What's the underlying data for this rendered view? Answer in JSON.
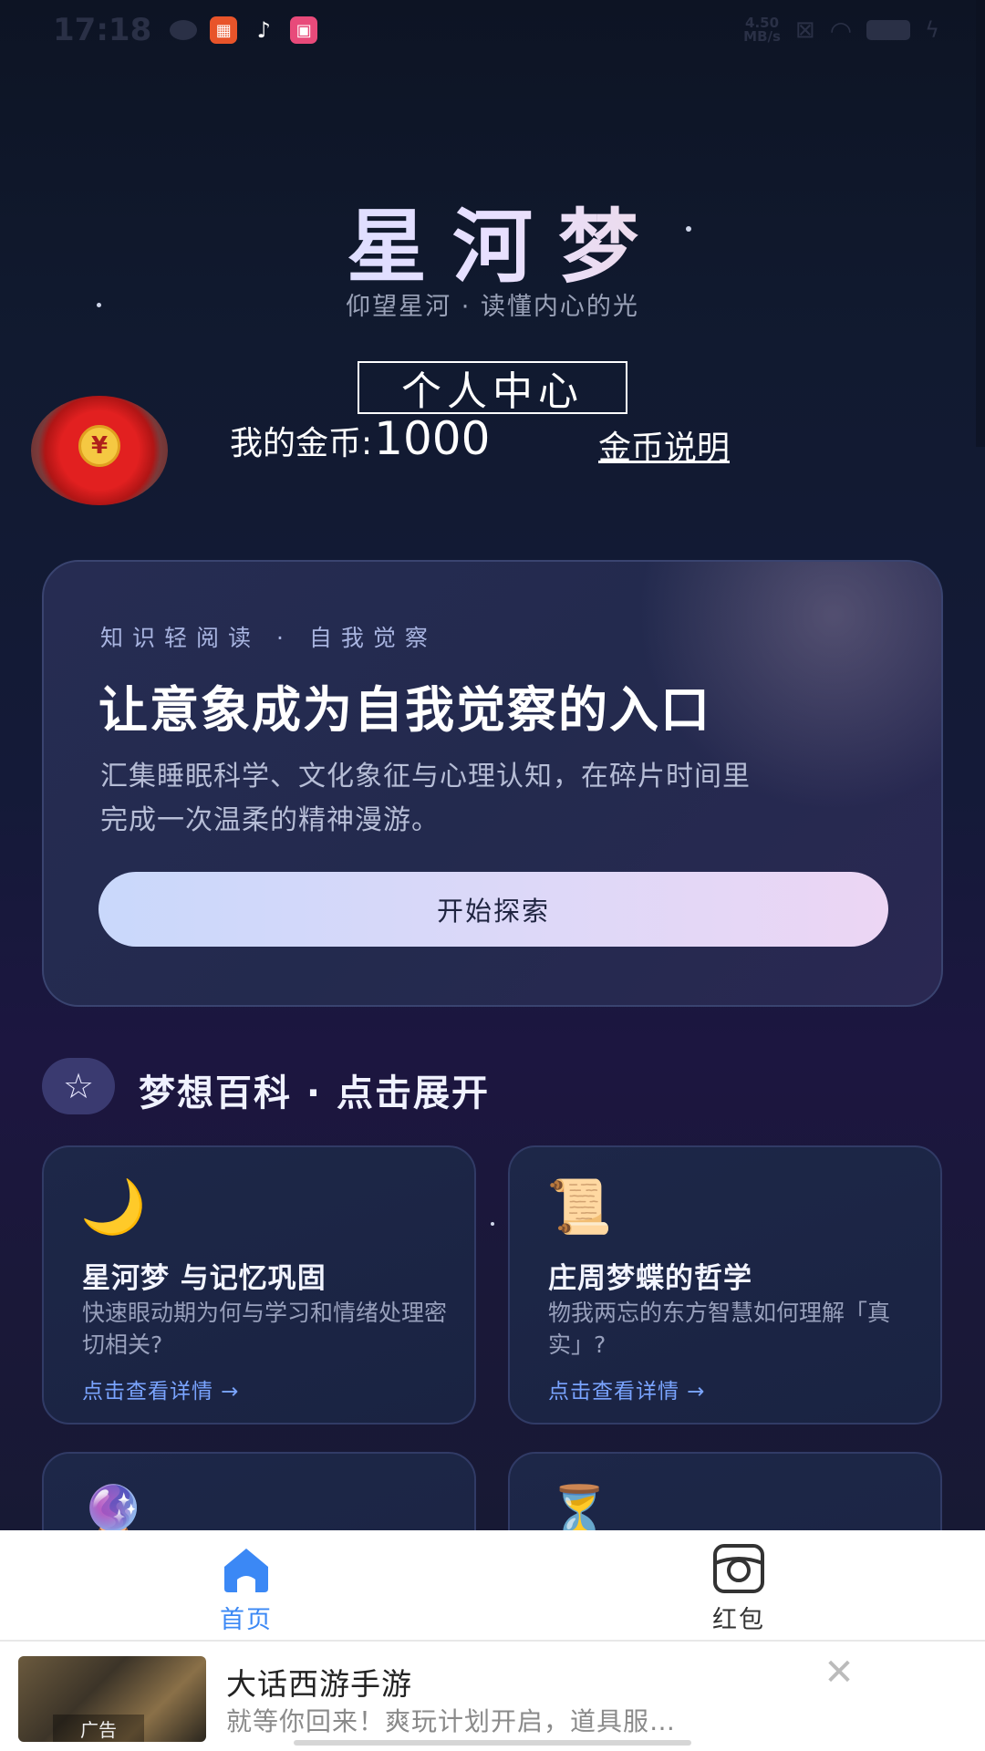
{
  "status_bar": {
    "time": "17:18",
    "speed_value": "4.50",
    "speed_unit": "MB/s",
    "apps": [
      "app-icon-orange",
      "tiktok-icon",
      "app-icon-pink"
    ]
  },
  "header": {
    "app_title": "星河梦",
    "subtitle": "仰望星河 · 读懂内心的光"
  },
  "profile": {
    "center_button": "个人中心",
    "coin_label": "我的金币:",
    "coin_value": "1000",
    "coin_link": "金币说明",
    "redpack_symbol": "¥"
  },
  "hero": {
    "kicker": "知识轻阅读 · 自我觉察",
    "title": "让意象成为自我觉察的入口",
    "desc_line1": "汇集睡眠科学、文化象征与心理认知，在碎片时间里",
    "desc_line2": "完成一次温柔的精神漫游。",
    "button": "开始探索"
  },
  "section": {
    "icon": "☆",
    "title": "梦想百科 · 点击展开"
  },
  "cards": [
    {
      "emoji": "🌙",
      "title": "星河梦 与记忆巩固",
      "desc": "快速眼动期为何与学习和情绪处理密切相关?",
      "link": "点击查看详情 →"
    },
    {
      "emoji": "📜",
      "title": "庄周梦蝶的哲学",
      "desc": "物我两忘的东方智慧如何理解「真实」?",
      "link": "点击查看详情 →"
    },
    {
      "emoji": "🔮"
    },
    {
      "emoji": "⏳"
    }
  ],
  "nav": {
    "home_label": "首页",
    "redpack_label": "红包",
    "active_color": "#3b88f5"
  },
  "ad": {
    "tag": "广告",
    "title": "大话西游手游",
    "desc": "就等你回来！爽玩计划开启，道具服…",
    "close": "✕"
  }
}
